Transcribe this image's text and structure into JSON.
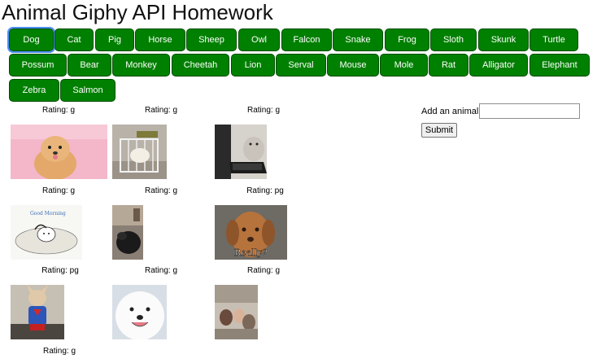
{
  "page": {
    "title": "Animal Giphy API Homework"
  },
  "buttons": [
    "Dog",
    "Cat",
    "Pig",
    "Horse",
    "Sheep",
    "Owl",
    "Falcon",
    "Snake",
    "Frog",
    "Sloth",
    "Skunk",
    "Turtle",
    "Possum",
    "Bear",
    "Monkey",
    "Cheetah",
    "Lion",
    "Serval",
    "Mouse",
    "Mole",
    "Rat",
    "Alligator",
    "Elephant",
    "Zebra",
    "Salmon"
  ],
  "colors": {
    "button_bg": "#008000",
    "button_text": "#ffffff"
  },
  "gifs": [
    {
      "rating": "Rating: g",
      "image": "pomeranian-puppy-pink-background"
    },
    {
      "rating": "Rating: g",
      "image": "puppy-in-playpen"
    },
    {
      "rating": "Rating: g",
      "image": "cat-at-laptop"
    },
    {
      "rating": "Rating: g",
      "image": "good-morning-cartoon-dog"
    },
    {
      "rating": "Rating: g",
      "image": "black-dog-indoors"
    },
    {
      "rating": "Rating: pg",
      "image": "puppy-really-meme"
    },
    {
      "rating": "Rating: pg",
      "image": "chihuahua-superman-costume"
    },
    {
      "rating": "Rating: g",
      "image": "white-fluffy-dog-smiling"
    },
    {
      "rating": "Rating: g",
      "image": "people-in-room"
    }
  ],
  "trailing_rating": "Rating: g",
  "form": {
    "label": "Add an animal",
    "input_value": "",
    "submit_label": "Submit"
  }
}
